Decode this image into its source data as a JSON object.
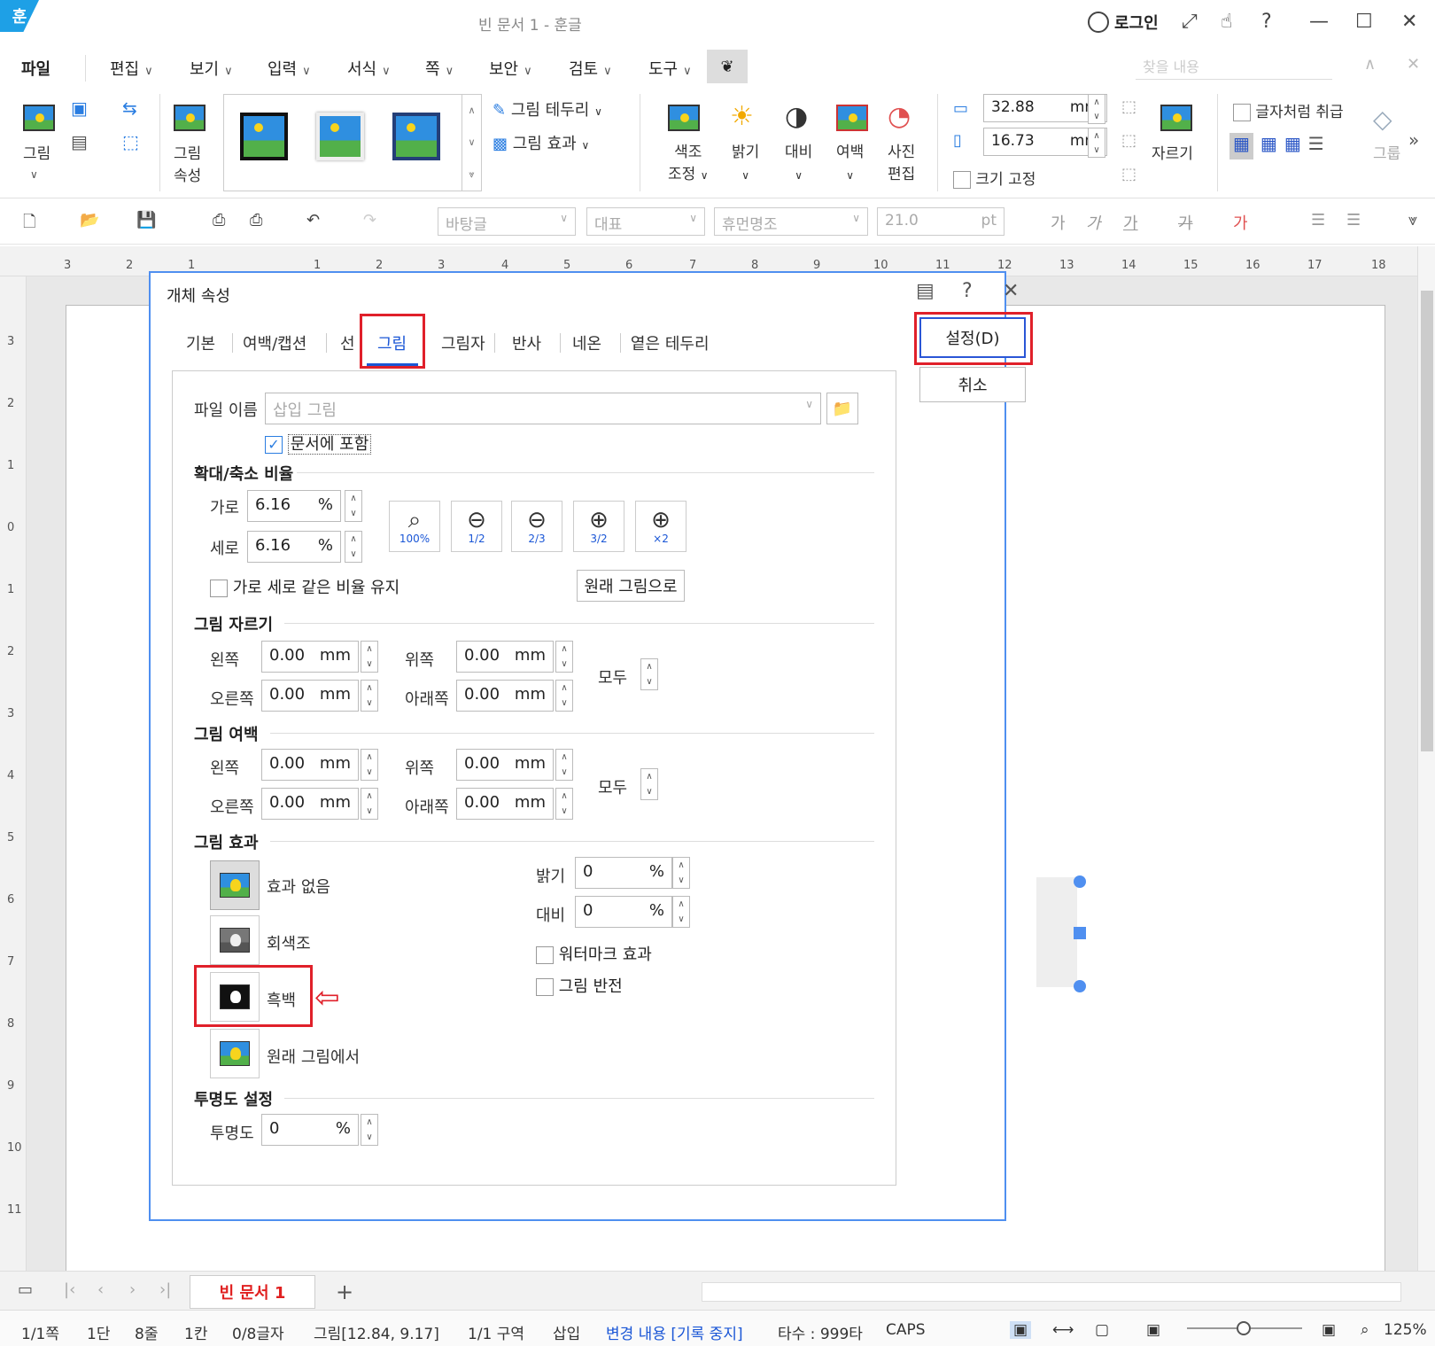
{
  "titlebar": {
    "logo": "훈",
    "title": "빈 문서 1 - 훈글",
    "login": "로그인"
  },
  "menu": {
    "items": [
      "파일",
      "편집",
      "보기",
      "입력",
      "서식",
      "쪽",
      "보안",
      "검토",
      "도구"
    ],
    "search_placeholder": "찾을 내용"
  },
  "ribbon": {
    "picture": "그림",
    "picture_props_1": "그림",
    "picture_props_2": "속성",
    "border": "그림 테두리",
    "effect": "그림 효과",
    "color_1": "색조",
    "color_2": "조정",
    "brightness": "밝기",
    "contrast": "대비",
    "margin": "여백",
    "photo_1": "사진",
    "photo_2": "편집",
    "width": "32.88",
    "height": "16.73",
    "unit": "mm",
    "lock_size": "크기 고정",
    "crop": "자르기",
    "as_char": "글자처럼 취급",
    "group": "그룹"
  },
  "toolbar2": {
    "style": "바탕글",
    "outline": "대표",
    "font": "휴먼명조",
    "size": "21.0",
    "size_unit": "pt",
    "chars": [
      "가",
      "가",
      "가",
      "가",
      "가"
    ]
  },
  "ruler": {
    "nums": [
      "3",
      "2",
      "1",
      "1",
      "1",
      "2",
      "3",
      "4",
      "5",
      "6",
      "7",
      "8",
      "9",
      "10",
      "11",
      "12",
      "13",
      "14",
      "15",
      "16",
      "17",
      "18"
    ],
    "vnums": [
      "3",
      "2",
      "1",
      "0",
      "1",
      "2",
      "3",
      "4",
      "5",
      "6",
      "7",
      "8",
      "9",
      "10",
      "11"
    ]
  },
  "dialog": {
    "title": "개체 속성",
    "tabs": [
      "기본",
      "여백/캡션",
      "선",
      "그림",
      "그림자",
      "반사",
      "네온",
      "옅은 테두리"
    ],
    "ok": "설정(D)",
    "cancel": "취소",
    "file_label": "파일 이름",
    "file_value": "삽입 그림",
    "include": "문서에 포함",
    "scale_title": "확대/축소 비율",
    "scale_h_label": "가로",
    "scale_h": "6.16",
    "scale_v_label": "세로",
    "scale_v": "6.16",
    "pct": "%",
    "zoom_buttons": [
      "100%",
      "1/2",
      "2/3",
      "3/2",
      "×2"
    ],
    "keep_ratio": "가로 세로 같은 비율 유지",
    "original_btn": "원래 그림으로",
    "crop_title": "그림 자르기",
    "margin_title": "그림 여백",
    "left": "왼쪽",
    "right": "오른쪽",
    "top": "위쪽",
    "bottom": "아래쪽",
    "all": "모두",
    "zero": "0.00",
    "mm": "mm",
    "effect_title": "그림 효과",
    "effects": [
      "효과 없음",
      "회색조",
      "흑백",
      "원래 그림에서"
    ],
    "brightness_label": "밝기",
    "brightness": "0",
    "contrast_label": "대비",
    "contrast": "0",
    "watermark": "워터마크 효과",
    "invert": "그림 반전",
    "trans_title": "투명도 설정",
    "trans_label": "투명도",
    "trans": "0"
  },
  "doctab": {
    "name": "빈 문서 1",
    "add": "+"
  },
  "status": {
    "page": "1/1쪽",
    "col": "1단",
    "line": "8줄",
    "pos": "1칸",
    "chars": "0/8글자",
    "obj": "그림[12.84, 9.17]",
    "section": "1/1 구역",
    "mode": "삽입",
    "track": "변경 내용 [기록 중지]",
    "typing": "타수 : 999타",
    "caps": "CAPS",
    "zoom": "125%"
  }
}
